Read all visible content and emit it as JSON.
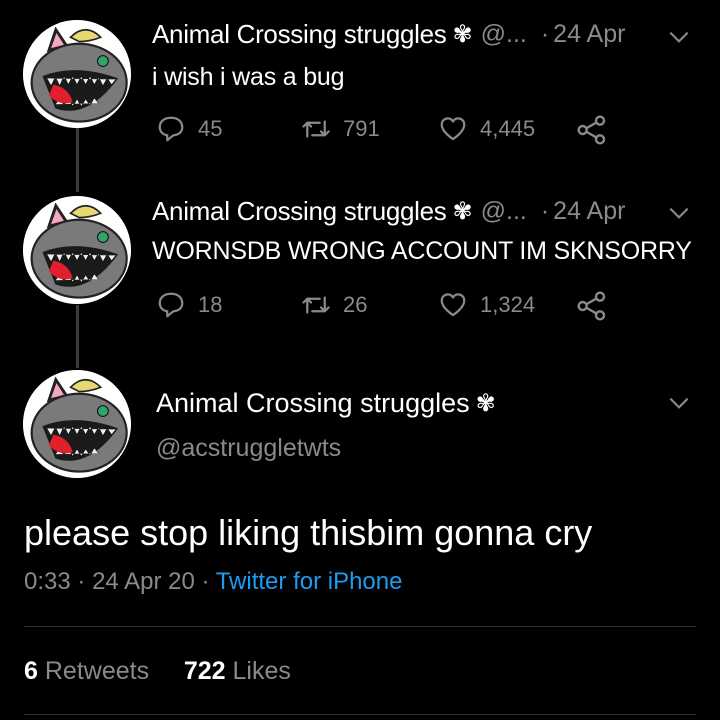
{
  "tweets": [
    {
      "name": "Animal Crossing struggles",
      "handle": "@...",
      "date": "24 Apr",
      "text": "i wish i was a bug",
      "replies": "45",
      "retweets": "791",
      "likes": "4,445"
    },
    {
      "name": "Animal Crossing struggles",
      "handle": "@...",
      "date": "24 Apr",
      "text": "WORNSDB WRONG ACCOUNT IM SKNSORRY",
      "replies": "18",
      "retweets": "26",
      "likes": "1,324"
    }
  ],
  "main": {
    "name": "Animal Crossing struggles",
    "handle": "@acstruggletwts",
    "text": "please stop liking thisbim gonna cry",
    "time": "0:33",
    "date": "24 Apr 20",
    "source": "Twitter for iPhone",
    "retweets_count": "6",
    "retweets_label": "Retweets",
    "likes_count": "722",
    "likes_label": "Likes"
  },
  "separator": "·",
  "badge_glyph": "✾",
  "icons": [
    "reply-icon",
    "retweet-icon",
    "like-icon",
    "share-icon",
    "chevron-down-icon",
    "clover-badge-icon"
  ],
  "colors": {
    "background": "#000000",
    "text": "#ffffff",
    "muted": "#8a8a8a",
    "link": "#1d9bf0"
  }
}
